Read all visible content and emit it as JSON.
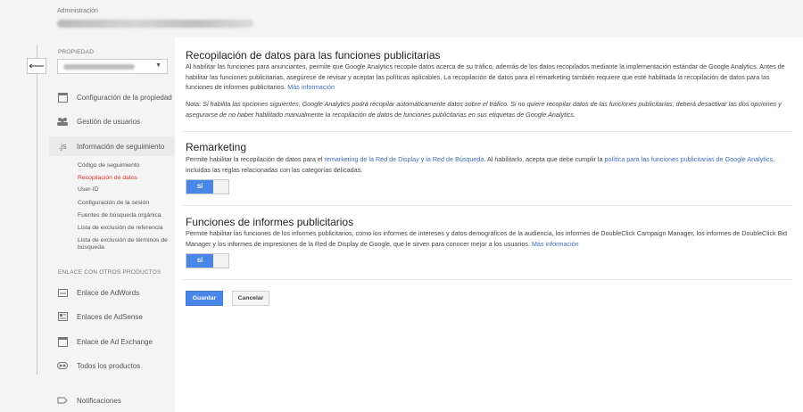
{
  "header": {
    "section": "Administración"
  },
  "sidebar": {
    "property_label": "PROPIEDAD",
    "items": [
      {
        "label": "Configuración de la propiedad"
      },
      {
        "label": "Gestión de usuarios"
      },
      {
        "label": "Información de seguimiento",
        "icon_text": ".js"
      }
    ],
    "sub_items": [
      "Código de seguimiento",
      "Recopilación de datos",
      "User-ID",
      "Configuración de la sesión",
      "Fuentes de búsqueda orgánica",
      "Lista de exclusión de referencia",
      "Lista de exclusión de términos de",
      "búsqueda"
    ],
    "products_label": "ENLACE CON OTROS PRODUCTOS",
    "products": [
      "Enlace de AdWords",
      "Enlaces de AdSense",
      "Enlace de Ad Exchange",
      "Todos los productos"
    ],
    "notifications": "Notificaciones"
  },
  "main": {
    "title": "Recopilación de datos para las funciones publicitarias",
    "intro_1": "Al habilitar las funciones para anunciantes, permite que Google Analytics recopile datos acerca de su tráfico, además de los datos recopilados mediante la implementación estándar de Google",
    "intro_2": "Analytics. Antes de habilitar las funciones publicitarias, asegúrese de revisar y aceptar las políticas aplicables. La recopilación de datos para el remarketing también requiere que esté habilitada la",
    "intro_3": "recopilación de datos para las funciones de informes publicitarios.",
    "intro_link": "Más información",
    "note_prefix": "Nota:",
    "note_1": "Si habilita las opciones siguientes, Google Analytics podrá recopilar automáticamente datos sobre el tráfico. Si no quiere recopilar datos de las funciones publicitarias, deberá desactivar las dos",
    "note_2": "opciones y asegurarse de no haber habilitado manualmente la recopilación de datos de funciones publicitarias en sus etiquetas de Google Analytics.",
    "remarketing": {
      "title": "Remarketing",
      "text_1": "Permite habilitar la recopilación de datos para el",
      "link_1": "remarketing de la Red de Display y la Red de Búsqueda",
      "text_2": ". Al habilitarlo, acepta que debe cumplir la",
      "link_2": "política para las funciones publicitarias de Google",
      "link_3": "Analytics",
      "text_3": ", incluidas las reglas relacionadas con las categorías delicadas.",
      "toggle": "SÍ"
    },
    "reports": {
      "title": "Funciones de informes publicitarios",
      "text_1": "Permite habilitar las funciones de los informes publicitarios, como los informes de intereses y datos demográficos de la audiencia, los informes de DoubleClick Campaign Manager, los informes de",
      "text_2": "DoubleClick Bid Manager y los informes de impresiones de la Red de Display de Google, que le sirven para conocer mejor a los usuarios.",
      "link": "Más información",
      "toggle": "SÍ"
    },
    "save": "Guardar",
    "cancel": "Cancelar"
  }
}
